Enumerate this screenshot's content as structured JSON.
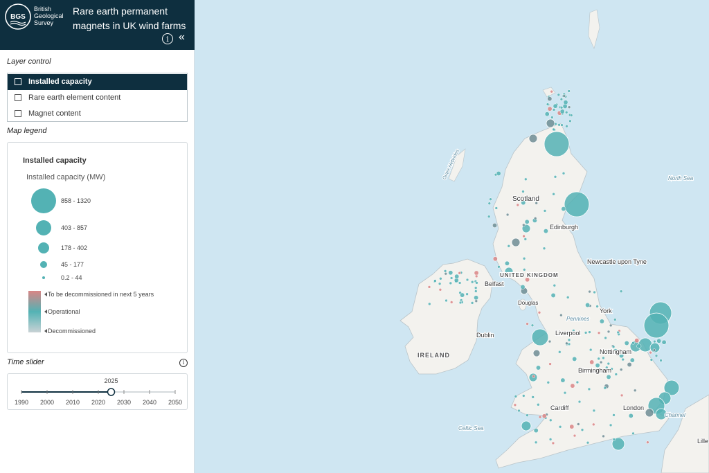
{
  "header": {
    "org_name": "British Geological Survey",
    "logo_text": "BGS",
    "title": "Rare earth permanent magnets in UK wind farms",
    "info_icon": "info-icon",
    "collapse_icon": "double-chevron-left-icon"
  },
  "layer_control": {
    "label": "Layer control",
    "items": [
      {
        "label": "Installed capacity",
        "active": true
      },
      {
        "label": "Rare earth element content",
        "active": false
      },
      {
        "label": "Magnet content",
        "active": false
      }
    ]
  },
  "legend": {
    "label": "Map legend",
    "title": "Installed capacity",
    "subtitle": "Installed capacity (MW)",
    "classes": [
      "858 - 1320",
      "403 - 857",
      "178 - 402",
      "45 - 177",
      "0.2 - 44"
    ],
    "status": [
      "To be decommissioned in next 5 years",
      "Operational",
      "Decommissioned"
    ],
    "colors": {
      "operational": "#53b2b4",
      "decommissioning": "#d98585",
      "decommissioned": "#c9d2d5"
    }
  },
  "time_slider": {
    "label": "Time slider",
    "value": 2025,
    "value_label": "2025",
    "ticks": [
      "1990",
      "2000",
      "2010",
      "2020",
      "2030",
      "2040",
      "2050"
    ],
    "min": 1990,
    "max": 2050
  },
  "map": {
    "places": [
      "Scotland",
      "Edinburgh",
      "Newcastle upon Tyne",
      "Belfast",
      "Dublin",
      "IRELAND",
      "York",
      "Liverpool",
      "Nottingham",
      "Birmingham",
      "Cardiff",
      "London",
      "Douglas",
      "Pennines",
      "Outer Hebrides",
      "North Sea",
      "Celtic Sea",
      "UNITED KINGDOM",
      "Channel",
      "Lille"
    ],
    "sea_color": "#cfe6f2",
    "land_color": "#f3f2ee"
  }
}
